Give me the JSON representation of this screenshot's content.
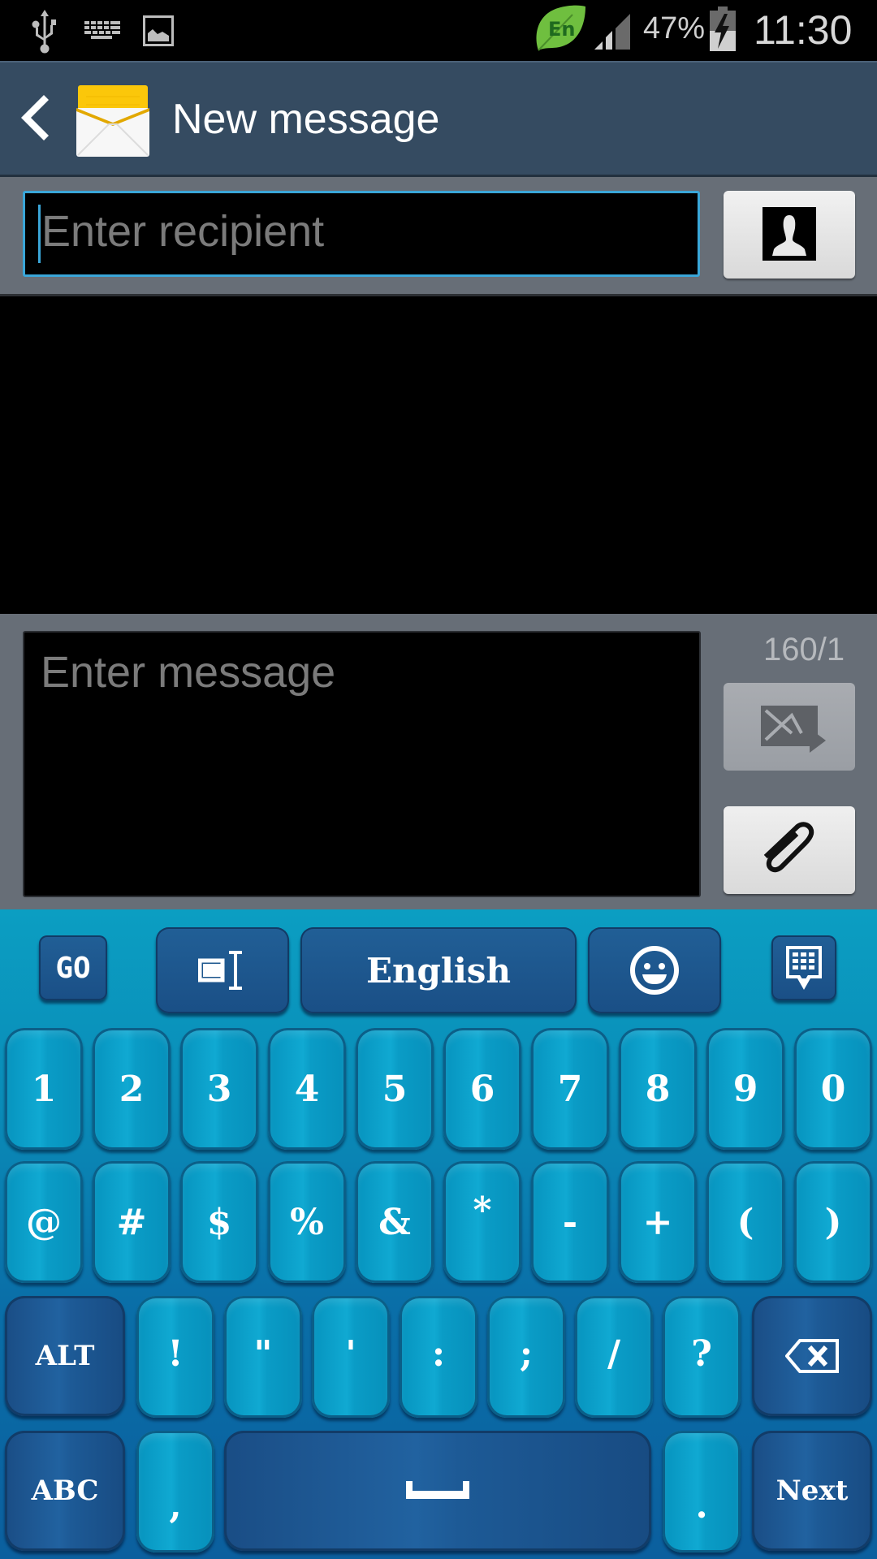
{
  "status_bar": {
    "icons": [
      "usb-icon",
      "keyboard-icon",
      "picture-icon",
      "language-en-icon",
      "signal-icon",
      "battery-charging-icon"
    ],
    "language_badge": "En",
    "battery_percent": "47%",
    "time": "11:30"
  },
  "action_bar": {
    "title": "New message",
    "back_icon": "chevron-left-icon",
    "app_icon": "envelope-icon"
  },
  "recipient": {
    "placeholder": "Enter recipient",
    "value": "",
    "contact_button_icon": "contact-icon"
  },
  "compose": {
    "placeholder": "Enter message",
    "value": "",
    "char_counter": "160/1",
    "send_button_icon": "send-message-icon",
    "attach_button_icon": "paperclip-icon"
  },
  "keyboard": {
    "accent_color": "#0a9cc6",
    "dark_key_color": "#1d5a96",
    "toolbar": {
      "go_label": "GO",
      "language_label": "English",
      "buttons": [
        "go-button",
        "text-edit-button",
        "language-button",
        "emoji-button",
        "hide-keyboard-button"
      ]
    },
    "row1": [
      "1",
      "2",
      "3",
      "4",
      "5",
      "6",
      "7",
      "8",
      "9",
      "0"
    ],
    "row2": [
      "@",
      "#",
      "$",
      "%",
      "&",
      "*",
      "-",
      "+",
      "(",
      ")"
    ],
    "row3": {
      "alt_label": "ALT",
      "keys": [
        "!",
        "\"",
        "'",
        ":",
        ";",
        "/",
        "?"
      ],
      "backspace_icon": "backspace-icon"
    },
    "row4": {
      "abc_label": "ABC",
      "comma": ",",
      "space_icon": "space-icon",
      "period": ".",
      "next_label": "Next"
    }
  }
}
